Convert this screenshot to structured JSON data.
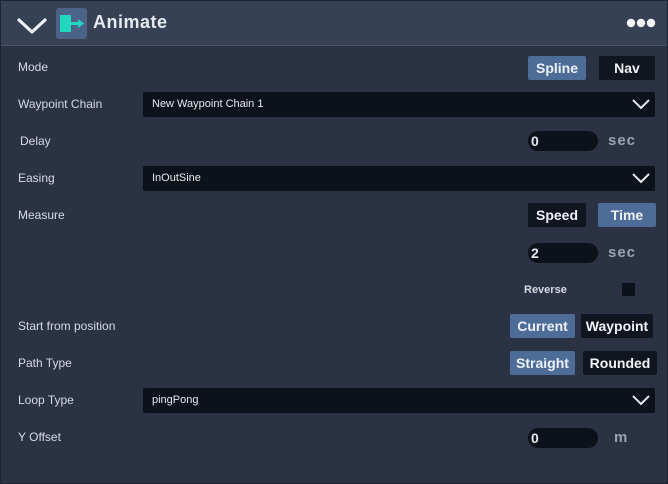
{
  "header": {
    "title": "Animate",
    "collapse_icon": "chevron-down-icon",
    "component_icon": "animate-component-icon",
    "more_icon": "ellipsis-icon"
  },
  "mode": {
    "label": "Mode",
    "options": [
      "Spline",
      "Nav"
    ],
    "selected": "Spline"
  },
  "waypoint_chain": {
    "label": "Waypoint Chain",
    "value": "New Waypoint Chain 1"
  },
  "delay": {
    "label": "Delay",
    "value": "0",
    "unit": "sec"
  },
  "easing": {
    "label": "Easing",
    "value": "InOutSine"
  },
  "measure": {
    "label": "Measure",
    "options": [
      "Speed",
      "Time"
    ],
    "selected": "Time",
    "value": "2",
    "unit": "sec"
  },
  "reverse": {
    "label": "Reverse",
    "checked": false
  },
  "start_from_position": {
    "label": "Start from position",
    "options": [
      "Current",
      "Waypoint"
    ],
    "selected": "Current"
  },
  "path_type": {
    "label": "Path Type",
    "options": [
      "Straight",
      "Rounded"
    ],
    "selected": "Straight"
  },
  "loop_type": {
    "label": "Loop Type",
    "value": "pingPong"
  },
  "y_offset": {
    "label": "Y Offset",
    "value": "0",
    "unit": "m"
  },
  "colors": {
    "panel_bg": "#2a3244",
    "header_bg": "#364156",
    "accent": "#4d6c98",
    "field_bg": "#0d1119",
    "icon_teal": "#22d6c0"
  }
}
